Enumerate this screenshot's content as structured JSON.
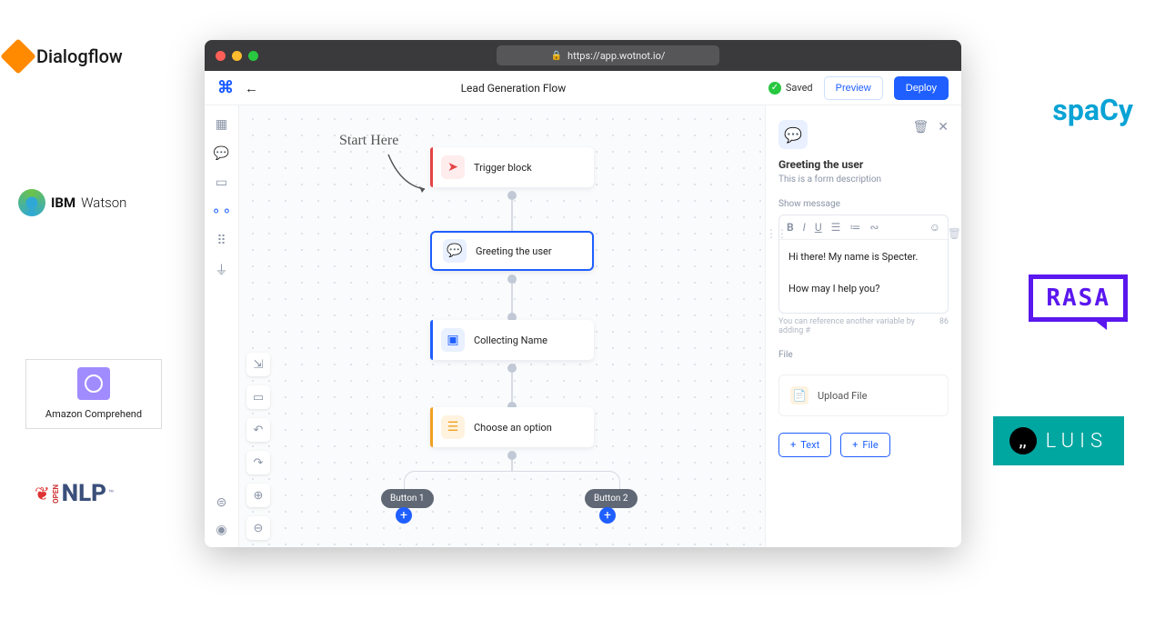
{
  "browser": {
    "url": "https://app.wotnot.io/"
  },
  "header": {
    "title": "Lead Generation Flow",
    "saved": "Saved",
    "preview": "Preview",
    "deploy": "Deploy"
  },
  "canvas": {
    "start_here": "Start Here",
    "blocks": {
      "trigger": "Trigger block",
      "greeting": "Greeting the user",
      "collecting": "Collecting Name",
      "choose": "Choose an option"
    },
    "button1": "Button 1",
    "button2": "Button 2"
  },
  "panel": {
    "title": "Greeting the user",
    "description": "This is a form description",
    "show_message": "Show message",
    "message_line1": "Hi there! My name is Specter.",
    "message_line2": "How may I help you?",
    "hint": "You can reference another variable by adding #",
    "char_count": "86",
    "file_label": "File",
    "upload_file": "Upload File",
    "add_text": "Text",
    "add_file": "File"
  },
  "logos": {
    "dialogflow": "Dialogflow",
    "ibm1": "IBM",
    "ibm2": "Watson",
    "comprehend": "Amazon Comprehend",
    "opennlp_open": "OPEN",
    "opennlp_nlp": "NLP",
    "spacy": "spaCy",
    "rasa": "RASA",
    "luis": "LUIS"
  }
}
